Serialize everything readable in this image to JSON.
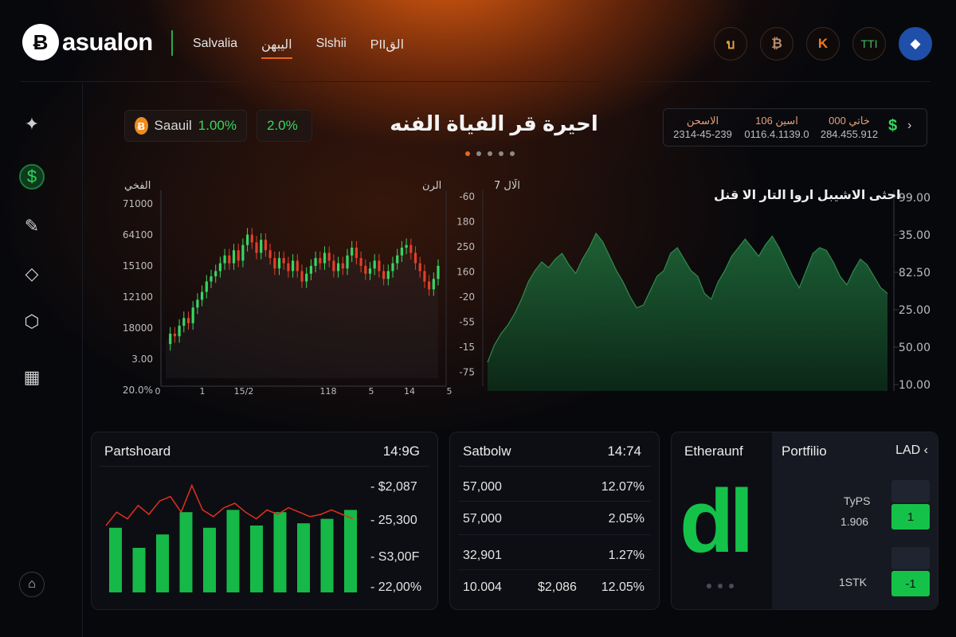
{
  "brand": {
    "logo_glyph": "Ƀ",
    "name": "asualon"
  },
  "nav": [
    "Salvalia",
    "اليبهن",
    "Slshii",
    "PIIالق"
  ],
  "top_icons": [
    {
      "icon": "loop-icon",
      "glyph": "บ",
      "color": "#e8a040"
    },
    {
      "icon": "bitcoin-outline-icon",
      "glyph": "₿",
      "color": "#b98a6a"
    },
    {
      "icon": "kucoin-icon",
      "glyph": "K",
      "color": "#f07a1e"
    },
    {
      "icon": "tm-icon",
      "glyph": "TTI",
      "color": "#38c060"
    },
    {
      "icon": "ethereum-icon",
      "glyph": "◆",
      "color": "#ffffff"
    }
  ],
  "sidebar": [
    {
      "name": "network-icon",
      "glyph": "✦"
    },
    {
      "name": "dollar-icon",
      "glyph": "$"
    },
    {
      "name": "pencil-icon",
      "glyph": "✎"
    },
    {
      "name": "ethereum-icon",
      "glyph": "◇"
    },
    {
      "name": "shield-icon",
      "glyph": "⬡"
    },
    {
      "name": "grid-icon",
      "glyph": "▦"
    },
    {
      "name": "exit-icon",
      "glyph": "⌂"
    }
  ],
  "ticker": {
    "coin": "Ƀ",
    "label": "Saauil",
    "change1": "1.00%",
    "change2": "2.0%"
  },
  "hero_title": "احيرة قر الفياة الفنه",
  "carousel": {
    "pages": 5,
    "active": 0
  },
  "stats": [
    {
      "l1": "الاسحن",
      "l2": "2314-45-239"
    },
    {
      "l1": "106 اسين",
      "l2": "0116.4.1139.0"
    },
    {
      "l1": "000 خاتي",
      "l2": "284.455.912"
    }
  ],
  "stat_icon": "$",
  "chart_data": [
    {
      "type": "line",
      "subtype": "candlestick",
      "title": "",
      "corner_labels": [
        "الفخي",
        "الرن"
      ],
      "y_ticks": [
        "71000",
        "64100",
        "15100",
        "12100",
        "18000",
        "3.00",
        "20.0%"
      ],
      "x_ticks": [
        "0",
        "1",
        "15/2",
        "118",
        "5",
        "14",
        "5"
      ],
      "mid_label": "7 الَال",
      "mid_ticks": [
        "-60",
        "180",
        "250",
        "160",
        "-20",
        "-55",
        "-15",
        "-75"
      ],
      "series": [
        {
          "values": [
            12.2,
            12.6,
            12.5,
            12.9,
            13.2,
            13.0,
            13.6,
            13.9,
            14.2,
            14.6,
            14.8,
            15.0,
            15.3,
            15.6,
            15.3,
            15.8,
            15.4,
            16.0,
            16.4,
            16.1,
            15.7,
            16.2,
            15.8,
            15.5,
            15.1,
            15.5,
            15.3,
            15.0,
            15.4,
            15.0,
            14.6,
            14.9,
            15.2,
            15.5,
            15.3,
            15.7,
            15.4,
            15.0,
            15.3,
            15.1,
            15.6,
            15.9,
            15.5,
            15.2,
            14.9,
            15.1,
            15.4,
            15.0,
            14.7,
            15.0,
            15.3,
            15.6,
            15.9,
            16.0,
            15.7,
            15.3,
            15.0,
            14.6,
            14.3,
            14.7,
            15.2
          ]
        }
      ]
    },
    {
      "type": "area",
      "title": "احثى الاشيبل اروا التار الا قنل",
      "y_ticks_right": [
        "99.00",
        "35.00",
        "82.50",
        "25.00",
        "50.00",
        "10.00"
      ],
      "series": [
        {
          "values": [
            20,
            26,
            30,
            33,
            37,
            42,
            48,
            52,
            55,
            53,
            56,
            58,
            54,
            51,
            56,
            60,
            65,
            62,
            57,
            52,
            48,
            43,
            39,
            40,
            45,
            50,
            52,
            58,
            60,
            56,
            52,
            50,
            44,
            42,
            48,
            52,
            57,
            60,
            63,
            60,
            57,
            61,
            64,
            60,
            55,
            50,
            46,
            52,
            58,
            60,
            59,
            55,
            50,
            47,
            52,
            56,
            54,
            50,
            46,
            44
          ]
        }
      ]
    },
    {
      "type": "bar",
      "title": "Partshoard",
      "values": [
        58,
        40,
        52,
        72,
        58,
        74,
        60,
        72,
        62,
        66,
        74
      ],
      "line": [
        60,
        72,
        66,
        78,
        70,
        82,
        86,
        72,
        96,
        74,
        68,
        76,
        80,
        72,
        66,
        74,
        70,
        76,
        72,
        68,
        70,
        74,
        70,
        66
      ]
    }
  ],
  "cards": {
    "partshoard": {
      "title": "Partshoard",
      "count": "14:9G",
      "values": [
        "- $2,087",
        "- 25,300",
        "- S3,00F",
        "- 22,00%"
      ]
    },
    "satbolw": {
      "title": "Satbolw",
      "count": "14:74",
      "rows": [
        [
          "57,000",
          "12.07%"
        ],
        [
          "57,000",
          "2.05%"
        ],
        [
          "32,901",
          "1.27%"
        ]
      ],
      "last_row": [
        "10.004",
        "$2,086",
        "12.05%"
      ]
    },
    "ethereum": {
      "title": "Etheraunf",
      "glyph": "dl"
    },
    "portfolio": {
      "title": "Portfilio",
      "currency": "LAD ‹",
      "label1": "TyPS",
      "label2": "1.906",
      "label3": "1STK",
      "box1": "1",
      "box2": "-1"
    }
  },
  "colors": {
    "accent": "#e8661c",
    "up": "#38d660",
    "down": "#e0402a",
    "area": "#1b6a38"
  }
}
